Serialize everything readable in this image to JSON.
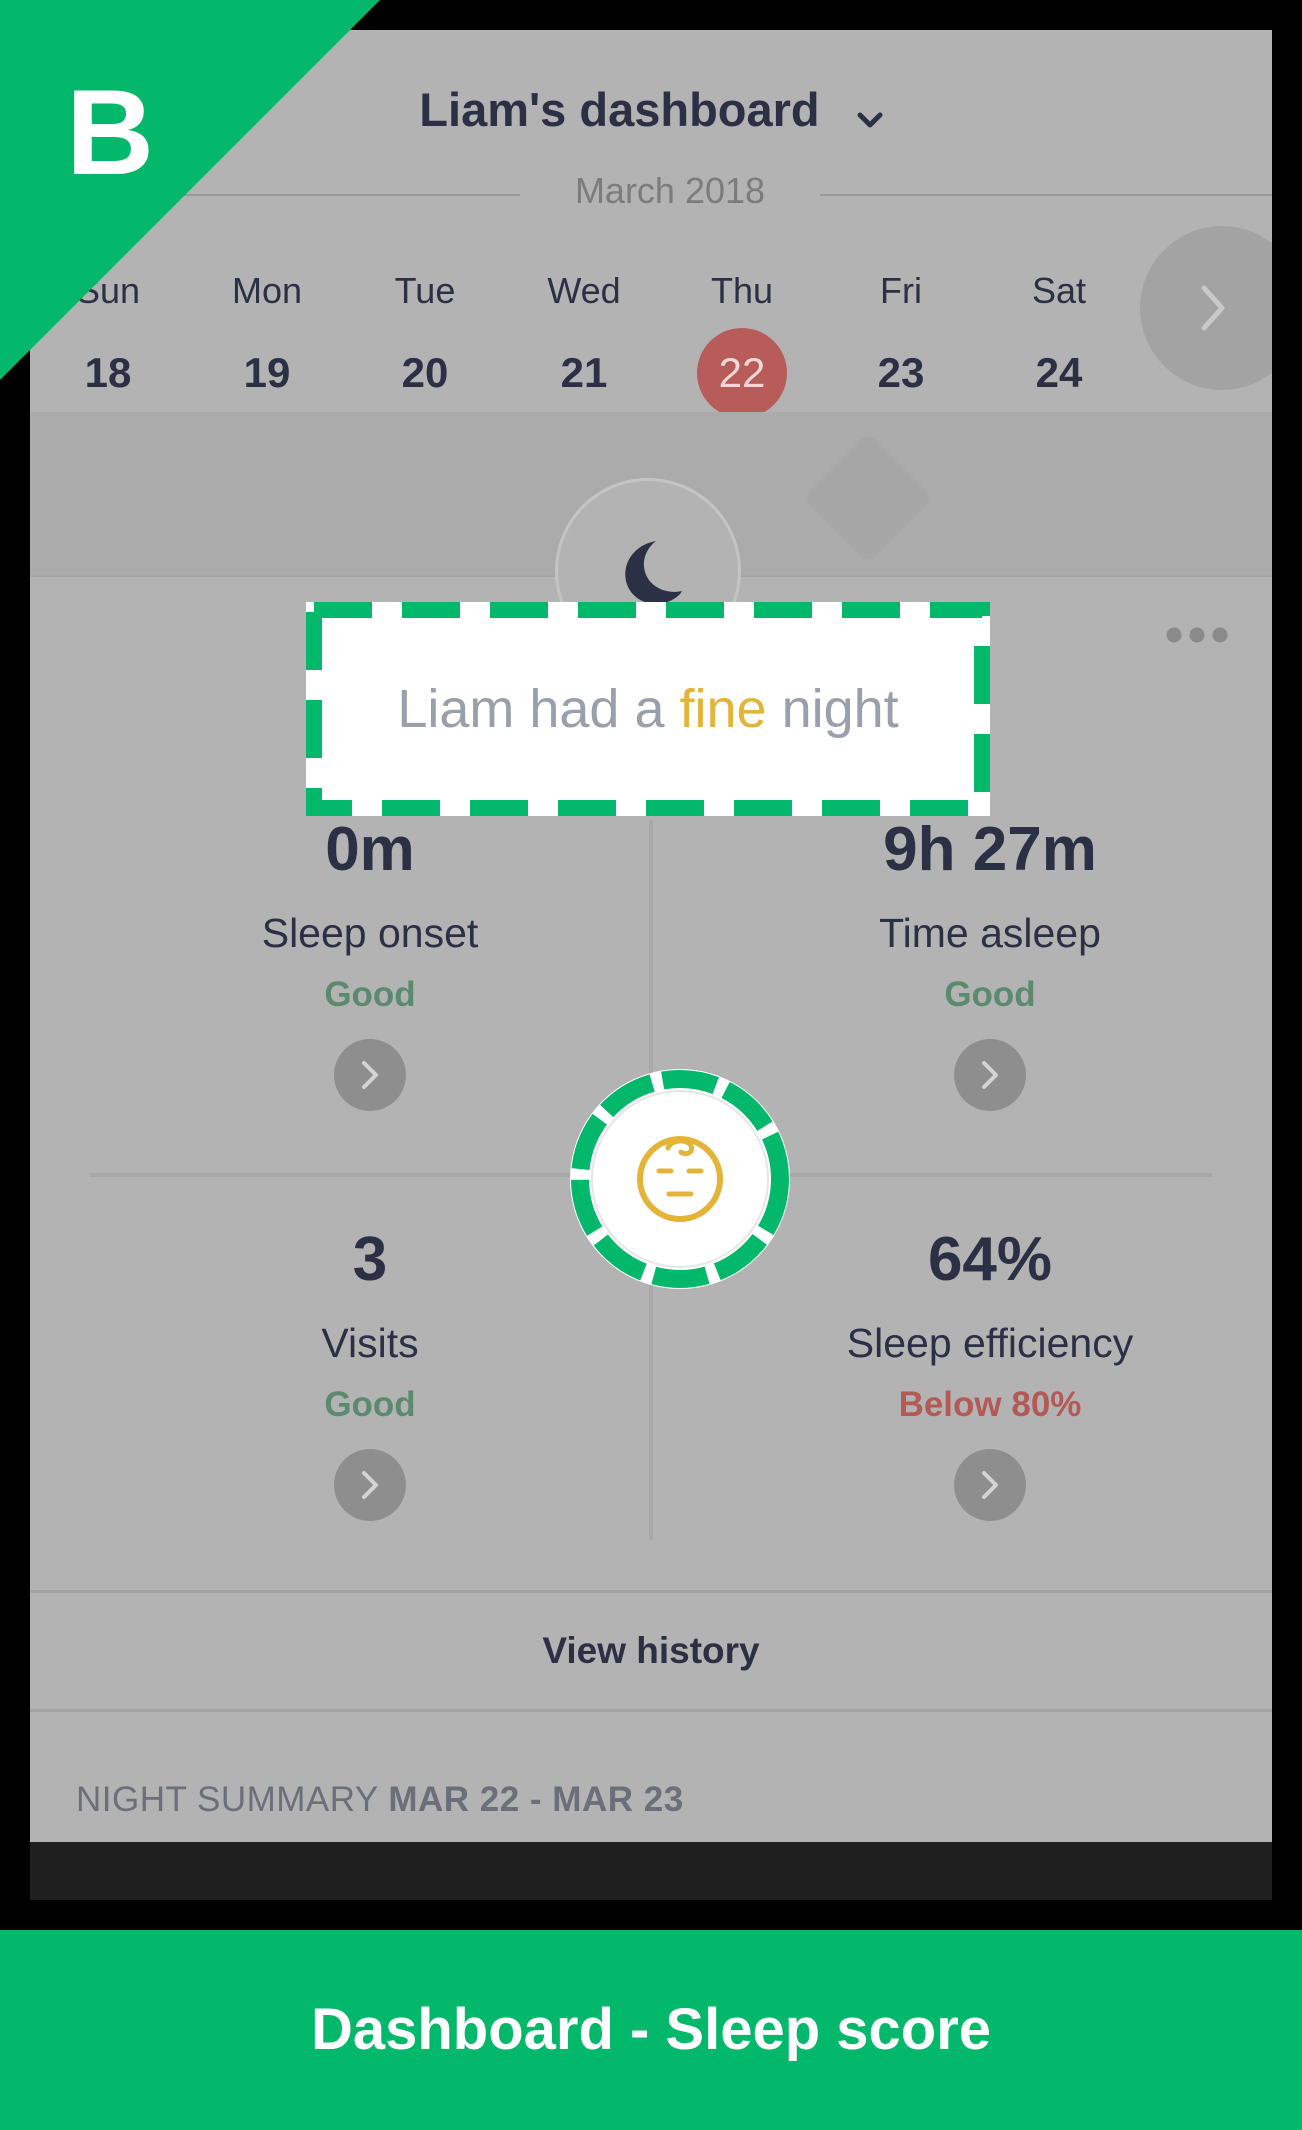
{
  "header": {
    "title": "Liam's dashboard"
  },
  "calendar": {
    "month": "March 2018",
    "days": [
      {
        "dow": "Sun",
        "num": "18"
      },
      {
        "dow": "Mon",
        "num": "19"
      },
      {
        "dow": "Tue",
        "num": "20"
      },
      {
        "dow": "Wed",
        "num": "21"
      },
      {
        "dow": "Thu",
        "num": "22",
        "selected": true
      },
      {
        "dow": "Fri",
        "num": "23"
      },
      {
        "dow": "Sat",
        "num": "24"
      }
    ]
  },
  "headline": {
    "pre": "Liam had a ",
    "highlight": "fine",
    "post": " night"
  },
  "metrics": {
    "sleep_onset": {
      "value": "0m",
      "label": "Sleep onset",
      "status": "Good"
    },
    "time_asleep": {
      "value": "9h 27m",
      "label": "Time asleep",
      "status": "Good"
    },
    "visits": {
      "value": "3",
      "label": "Visits",
      "status": "Good"
    },
    "efficiency": {
      "value": "64%",
      "label": "Sleep efficiency",
      "status": "Below 80%"
    }
  },
  "view_history": "View history",
  "summary": {
    "prefix": "NIGHT SUMMARY ",
    "range": "MAR 22 - MAR 23"
  },
  "badge": {
    "letter": "B"
  },
  "caption": "Dashboard - Sleep score",
  "colors": {
    "accent": "#03b86a",
    "good": "#5b8a6e",
    "bad": "#b35a57",
    "highlight": "#e3b437",
    "selected_day": "#b75c58"
  },
  "icons": {
    "dropdown": "chevron-down-icon",
    "next": "chevron-right-icon",
    "moon": "moon-icon",
    "more": "more-dots-icon",
    "score": "baby-face-icon"
  }
}
